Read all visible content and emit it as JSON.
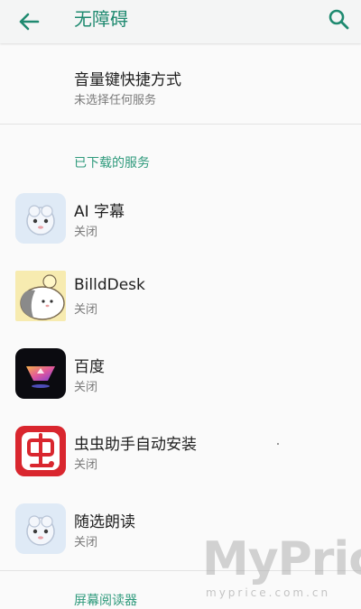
{
  "header": {
    "title": "无障碍",
    "back_icon": "arrow-back-icon",
    "search_icon": "search-icon",
    "accent_color": "#1f8a70"
  },
  "volume_shortcut": {
    "title": "音量键快捷方式",
    "subtitle": "未选择任何服务"
  },
  "downloaded_section": {
    "header": "已下载的服务",
    "items": [
      {
        "name": "AI 字幕",
        "status": "关闭",
        "icon": "sheep-face-icon"
      },
      {
        "name": "BilldDesk",
        "status": "关闭",
        "icon": "hamster-icon"
      },
      {
        "name": "百度",
        "status": "关闭",
        "icon": "baidu-bowl-icon"
      },
      {
        "name": "虫虫助手自动安装",
        "status": "关闭",
        "icon": "chongchong-icon"
      },
      {
        "name": "随选朗读",
        "status": "关闭",
        "icon": "sheep-face-icon"
      }
    ]
  },
  "next_section": {
    "header": "屏幕阅读器"
  },
  "watermark": {
    "main": "MyPrice",
    "sub": "myprice.com.cn"
  }
}
